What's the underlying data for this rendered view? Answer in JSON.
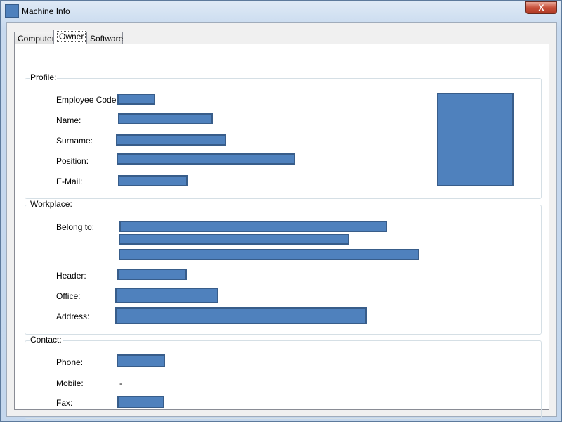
{
  "window": {
    "title": "Machine Info",
    "close_glyph": "X"
  },
  "tabs": [
    {
      "label": "Computer",
      "active": false
    },
    {
      "label": "Owner",
      "active": true
    },
    {
      "label": "Software",
      "active": false
    }
  ],
  "profile": {
    "legend": "Profile:",
    "employee_code_label": "Employee Code:",
    "name_label": "Name:",
    "surname_label": "Surname:",
    "position_label": "Position:",
    "email_label": "E-Mail:"
  },
  "workplace": {
    "legend": "Workplace:",
    "belong_to_label": "Belong to:",
    "header_label": "Header:",
    "office_label": "Office:",
    "address_label": "Address:"
  },
  "contact": {
    "legend": "Contact:",
    "phone_label": "Phone:",
    "mobile_label": "Mobile:",
    "mobile_value": "-",
    "fax_label": "Fax:"
  },
  "colors": {
    "redaction_fill": "#4f81bd",
    "redaction_border": "#385d8a"
  }
}
